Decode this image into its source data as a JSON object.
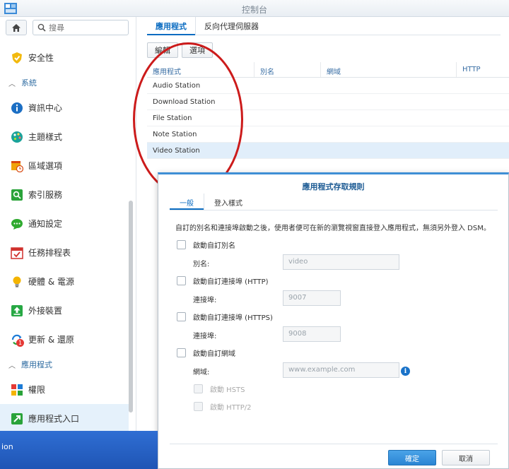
{
  "window": {
    "title": "控制台"
  },
  "sidebar": {
    "search_placeholder": "搜尋",
    "items": [
      {
        "label": "安全性",
        "icon": "shield-icon",
        "group": ""
      },
      {
        "label": "資訊中心",
        "icon": "info-icon"
      },
      {
        "label": "主題樣式",
        "icon": "palette-icon"
      },
      {
        "label": "區域選項",
        "icon": "calendar-clock-icon"
      },
      {
        "label": "索引服務",
        "icon": "search-index-icon"
      },
      {
        "label": "通知設定",
        "icon": "chat-bubble-icon"
      },
      {
        "label": "任務排程表",
        "icon": "task-calendar-icon"
      },
      {
        "label": "硬體 & 電源",
        "icon": "lightbulb-icon"
      },
      {
        "label": "外接裝置",
        "icon": "upload-device-icon"
      },
      {
        "label": "更新 & 還原",
        "icon": "update-restore-icon",
        "badge": "1"
      },
      {
        "label": "權限",
        "icon": "grid-permissions-icon"
      },
      {
        "label": "應用程式入口",
        "icon": "portal-arrow-icon"
      }
    ],
    "groups": {
      "system": "系統",
      "apps": "應用程式"
    }
  },
  "main": {
    "tabs": [
      "應用程式",
      "反向代理伺服器"
    ],
    "toolbar": {
      "edit": "編輯",
      "options": "選項"
    },
    "columns": [
      "應用程式",
      "別名",
      "網域",
      "HTTP"
    ],
    "rows": [
      "Audio Station",
      "Download Station",
      "File Station",
      "Note Station",
      "Video Station"
    ]
  },
  "dialog": {
    "title": "應用程式存取規則",
    "tabs": [
      "一般",
      "登入樣式"
    ],
    "description": "自訂的別名和連接埠啟動之後，使用者便可在新的瀏覽視窗直接登入應用程式，無須另外登入 DSM。",
    "alias": {
      "checkbox": "啟動自訂別名",
      "label": "別名:",
      "value": "video"
    },
    "http": {
      "checkbox": "啟動自訂連接埠 (HTTP)",
      "label": "連接埠:",
      "value": "9007"
    },
    "https": {
      "checkbox": "啟動自訂連接埠 (HTTPS)",
      "label": "連接埠:",
      "value": "9008"
    },
    "domain": {
      "checkbox": "啟動自訂網域",
      "label": "網域:",
      "placeholder": "www.example.com",
      "hsts": "啟動 HSTS",
      "http2": "啟動 HTTP/2"
    },
    "ok": "確定",
    "cancel": "取消"
  },
  "taskbar": {
    "text": "ion"
  },
  "colors": {
    "accent": "#0b6cc1",
    "annotation": "#cc1b1b"
  }
}
